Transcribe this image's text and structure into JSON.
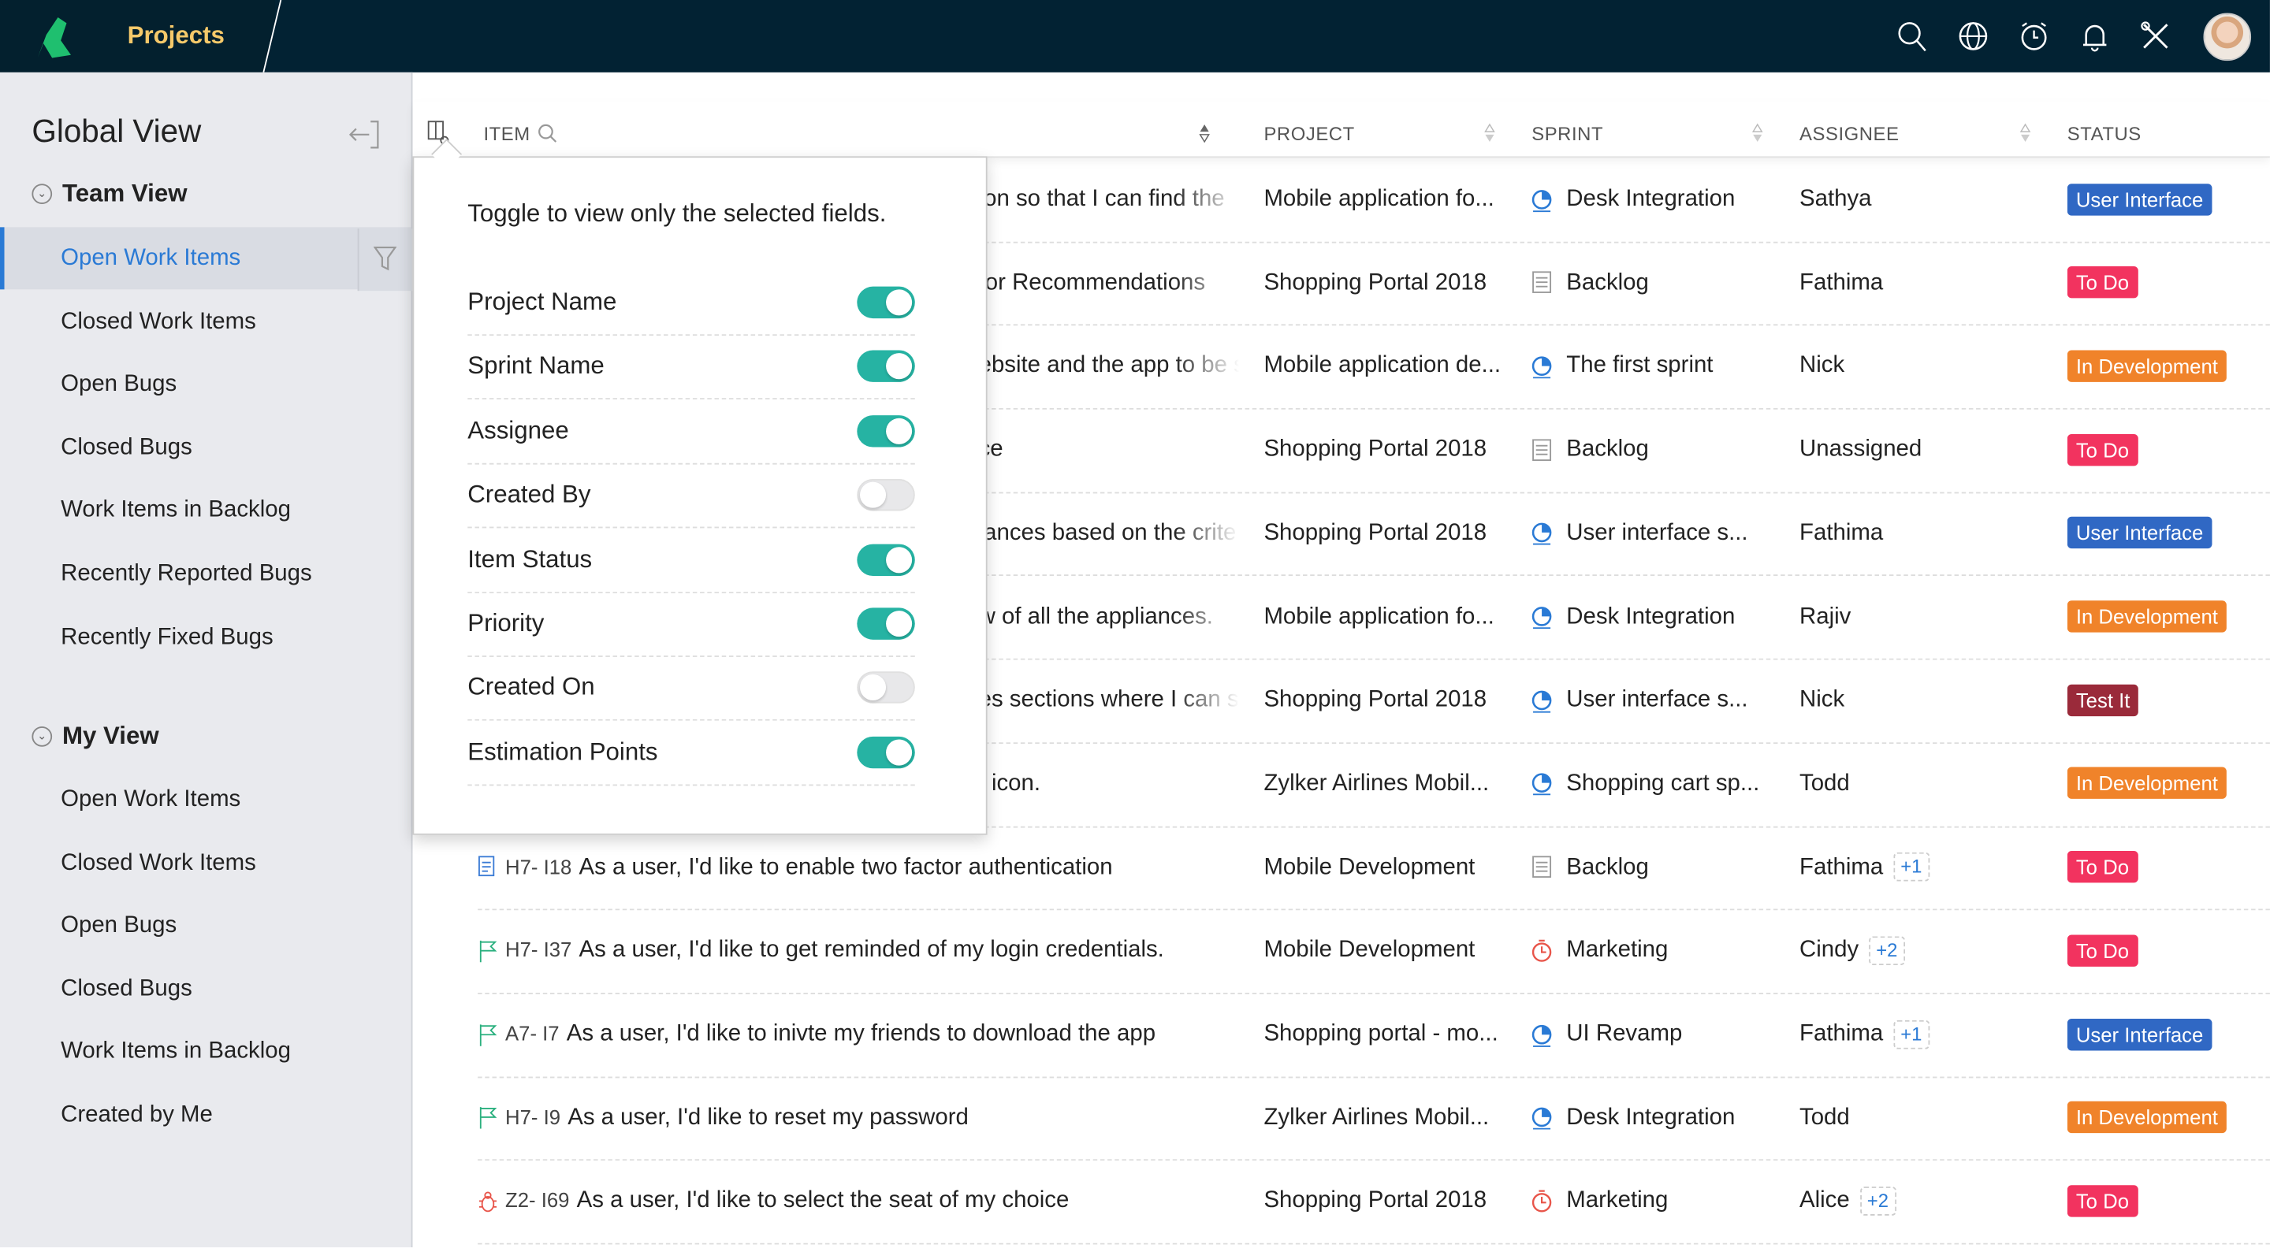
{
  "header": {
    "app_title": "Projects",
    "icons": [
      "search-icon",
      "globe-icon",
      "clock-icon",
      "bell-icon",
      "tools-icon",
      "avatar"
    ]
  },
  "sidebar": {
    "title": "Global View",
    "team_view": {
      "label": "Team View",
      "items": [
        {
          "label": "Open Work Items",
          "selected": true
        },
        {
          "label": "Closed Work Items"
        },
        {
          "label": "Open Bugs"
        },
        {
          "label": "Closed Bugs"
        },
        {
          "label": "Work Items in Backlog"
        },
        {
          "label": "Recently Reported Bugs"
        },
        {
          "label": "Recently Fixed Bugs"
        }
      ]
    },
    "my_view": {
      "label": "My View",
      "items": [
        {
          "label": "Open Work Items"
        },
        {
          "label": "Closed Work Items"
        },
        {
          "label": "Open Bugs"
        },
        {
          "label": "Closed Bugs"
        },
        {
          "label": "Work Items in Backlog"
        },
        {
          "label": "Created by Me"
        }
      ]
    }
  },
  "table": {
    "columns": {
      "item": "ITEM",
      "project": "PROJECT",
      "sprint": "SPRINT",
      "assignee": "ASSIGNEE",
      "status": "STATUS"
    },
    "rows": [
      {
        "item_fragment": "ion so that I can find the",
        "project": "Mobile application fo...",
        "sprint": "Desk Integration",
        "sprint_icon": "sprint",
        "assignee": "Sathya",
        "status": "User Interface"
      },
      {
        "item_fragment": "for Recommendations",
        "project": "Shopping Portal 2018",
        "sprint": "Backlog",
        "sprint_icon": "backlog",
        "assignee": "Fathima",
        "status": "To Do"
      },
      {
        "item_fragment": "ebsite and the app to be s",
        "project": "Mobile application de...",
        "sprint": "The first sprint",
        "sprint_icon": "sprint",
        "assignee": "Nick",
        "status": "In Development"
      },
      {
        "item_fragment": "ce",
        "project": "Shopping Portal 2018",
        "sprint": "Backlog",
        "sprint_icon": "backlog",
        "assignee": "Unassigned",
        "status": "To Do"
      },
      {
        "item_fragment": "iances based on the crite",
        "project": "Shopping Portal 2018",
        "sprint": "User interface s...",
        "sprint_icon": "sprint",
        "assignee": "Fathima",
        "status": "User Interface"
      },
      {
        "item_fragment": "w of all the appliances.",
        "project": "Mobile application fo...",
        "sprint": "Desk Integration",
        "sprint_icon": "sprint",
        "assignee": "Rajiv",
        "status": "In Development"
      },
      {
        "item_fragment": "es sections where I can s",
        "project": "Shopping Portal 2018",
        "sprint": "User interface s...",
        "sprint_icon": "sprint",
        "assignee": "Nick",
        "status": "Test It"
      },
      {
        "item_fragment": "t icon.",
        "project": "Zylker Airlines Mobil...",
        "sprint": "Shopping cart sp...",
        "sprint_icon": "sprint",
        "assignee": "Todd",
        "status": "In Development"
      },
      {
        "type": "story",
        "key": "H7- I18",
        "title": "As a user, I'd like to enable two factor authentication",
        "project": "Mobile Development",
        "sprint": "Backlog",
        "sprint_icon": "backlog",
        "assignee": "Fathima",
        "more": "+1",
        "status": "To Do"
      },
      {
        "type": "flag",
        "key": "H7- I37",
        "title": "As a user, I'd like to get reminded of my login credentials.",
        "project": "Mobile Development",
        "sprint": "Marketing",
        "sprint_icon": "timer",
        "assignee": "Cindy",
        "more": "+2",
        "status": "To Do"
      },
      {
        "type": "flag",
        "key": "A7- I7",
        "title": "As a user, I'd like to inivte my friends to download the app",
        "project": "Shopping portal - mo...",
        "sprint": "UI Revamp",
        "sprint_icon": "sprint",
        "assignee": "Fathima",
        "more": "+1",
        "status": "User Interface"
      },
      {
        "type": "flag",
        "key": "H7- I9",
        "title": "As a user, I'd like to reset my password",
        "project": "Zylker Airlines Mobil...",
        "sprint": "Desk Integration",
        "sprint_icon": "sprint",
        "assignee": "Todd",
        "status": "In Development"
      },
      {
        "type": "bug",
        "key": "Z2- I69",
        "title": "As a user, I'd like to select the seat of my choice",
        "project": "Shopping Portal 2018",
        "sprint": "Marketing",
        "sprint_icon": "timer",
        "assignee": "Alice",
        "more": "+2",
        "status": "To Do"
      }
    ]
  },
  "status_colors": {
    "User Interface": "#3068c4",
    "To Do": "#f2335f",
    "In Development": "#f0832a",
    "Test It": "#9a2a3a"
  },
  "popup": {
    "title": "Toggle to view only the selected fields.",
    "fields": [
      {
        "label": "Project Name",
        "on": true
      },
      {
        "label": "Sprint Name",
        "on": true
      },
      {
        "label": "Assignee",
        "on": true
      },
      {
        "label": "Created By",
        "on": false
      },
      {
        "label": "Item Status",
        "on": true
      },
      {
        "label": "Priority",
        "on": true
      },
      {
        "label": "Created On",
        "on": false
      },
      {
        "label": "Estimation Points",
        "on": true
      }
    ]
  },
  "colors": {
    "topbar": "#022233",
    "brand_title": "#f5c96a",
    "accent": "#2a7ad5",
    "toggle_on": "#26b3a3"
  }
}
